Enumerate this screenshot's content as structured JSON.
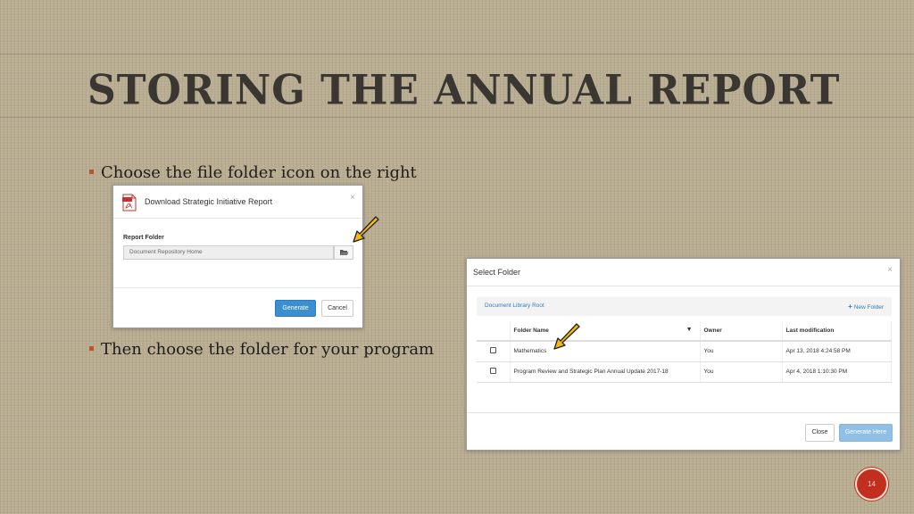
{
  "slide": {
    "title": "STORING THE ANNUAL REPORT",
    "bullets": [
      "Choose the file folder icon on the right",
      "Then choose the folder for your program"
    ],
    "page_number": "14"
  },
  "dialog_download": {
    "title": "Download Strategic Initiative Report",
    "close_glyph": "×",
    "report_folder_label": "Report Folder",
    "report_folder_value": "Document Repository Home",
    "generate_label": "Generate",
    "cancel_label": "Cancel"
  },
  "dialog_select_folder": {
    "title": "Select Folder",
    "close_glyph": "×",
    "breadcrumb": "Document Library Root",
    "new_folder_label": "New Folder",
    "columns": [
      "Folder Name",
      "Owner",
      "Last modification"
    ],
    "rows": [
      {
        "name": "Mathematics",
        "owner": "You",
        "modified": "Apr 13, 2018 4:24:58 PM"
      },
      {
        "name": "Program Review and Strategic Plan Annual Update 2017-18",
        "owner": "You",
        "modified": "Apr 4, 2018 1:10:30 PM"
      }
    ],
    "close_label": "Close",
    "generate_here_label": "Generate Here"
  },
  "colors": {
    "background": "#b9ad92",
    "accent_arrow": "#f5b80f",
    "primary_button": "#3b8fd0",
    "link": "#337ab7",
    "slide_number_badge": "#c22f1f"
  }
}
